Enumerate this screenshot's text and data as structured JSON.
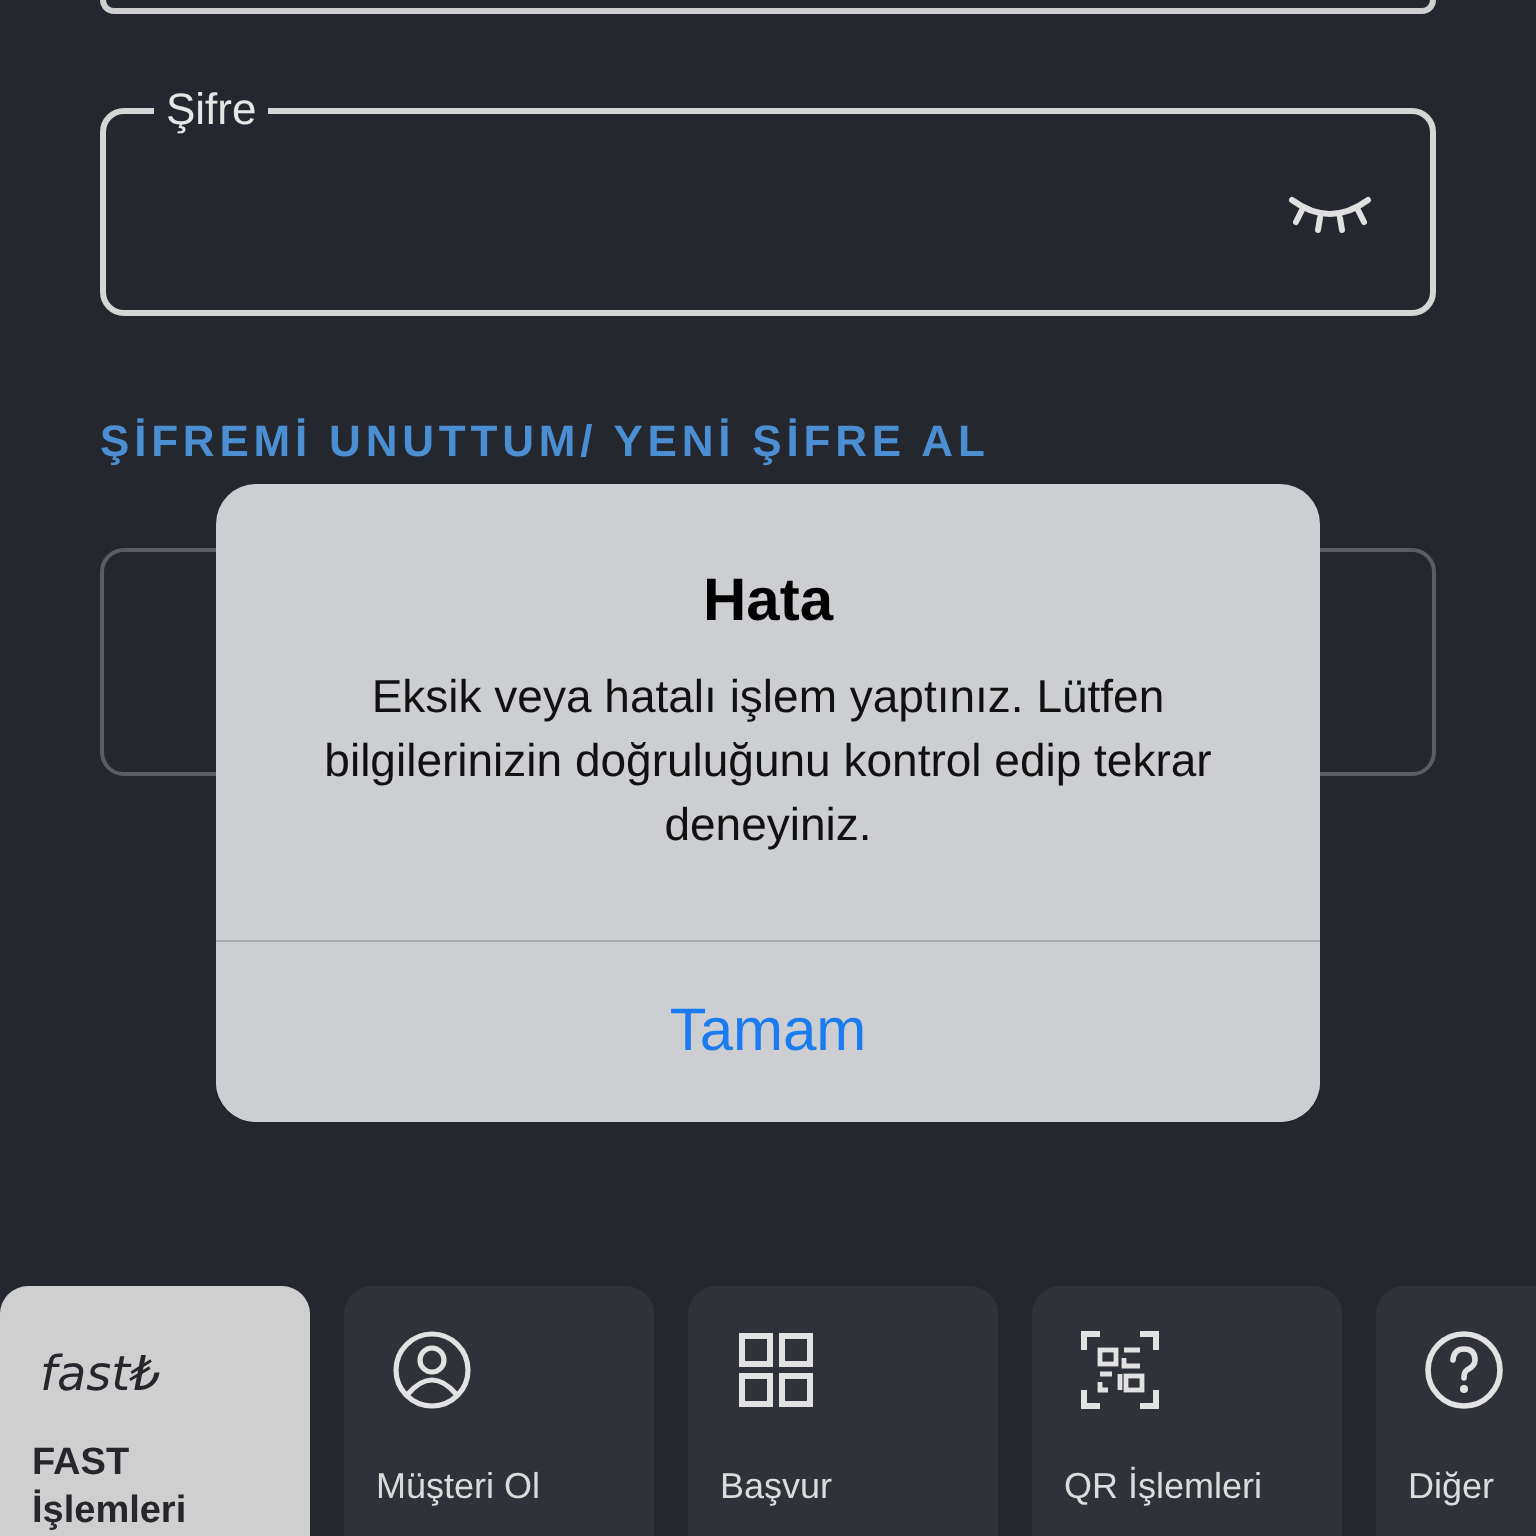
{
  "password_field": {
    "label": "Şifre",
    "masked": true
  },
  "forgot_link": "ŞİFREMİ UNUTTUM/ YENİ ŞİFRE AL",
  "alert": {
    "title": "Hata",
    "message": "Eksik veya hatalı işlem yaptınız. Lütfen bilgilerinizin doğruluğunu kontrol edip tekrar deneyiniz.",
    "button": "Tamam"
  },
  "tiles": [
    {
      "kind": "logo",
      "logo": "fast₺",
      "label": "FAST İşlemleri",
      "selected": true
    },
    {
      "kind": "user",
      "label": "Müşteri Ol",
      "selected": false
    },
    {
      "kind": "grid",
      "label": "Başvur",
      "selected": false
    },
    {
      "kind": "qr",
      "label": "QR İşlemleri",
      "selected": false
    },
    {
      "kind": "help",
      "label": "Diğer",
      "selected": false
    }
  ]
}
